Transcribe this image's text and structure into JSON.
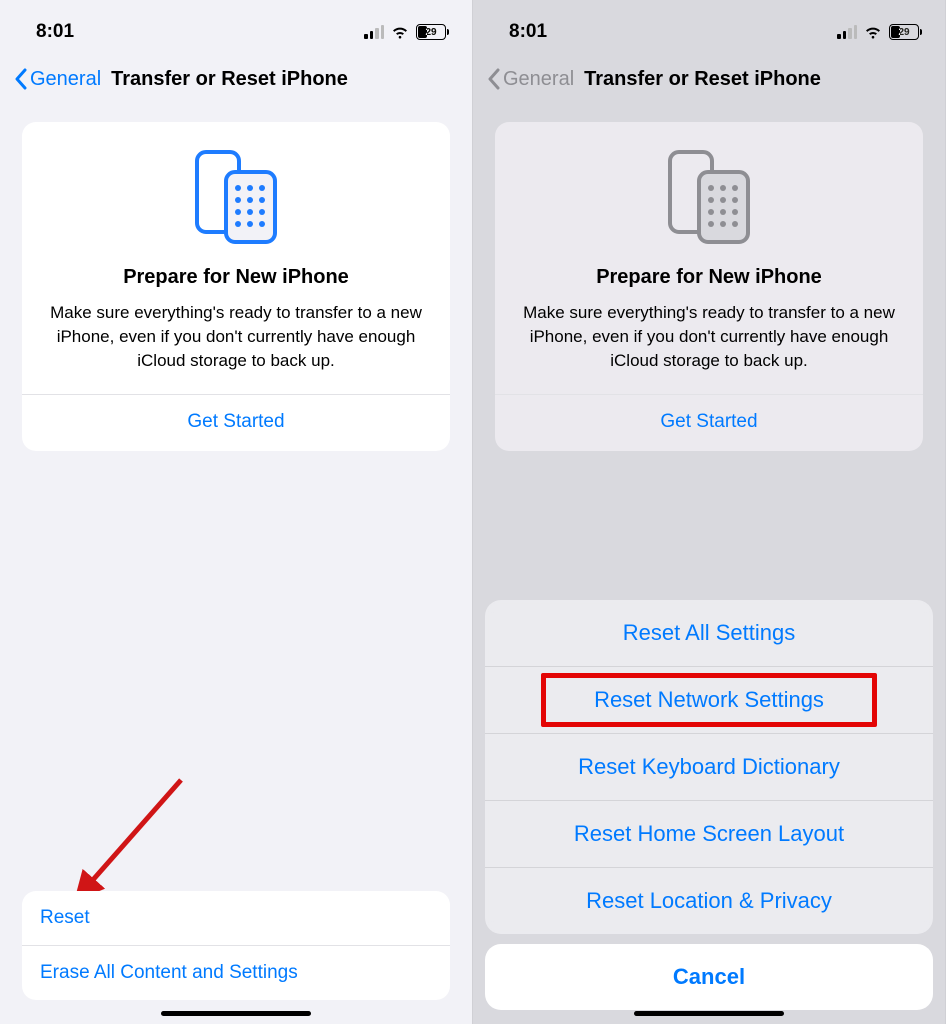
{
  "status": {
    "time": "8:01",
    "battery": "29"
  },
  "nav": {
    "back": "General",
    "title": "Transfer or Reset iPhone"
  },
  "card": {
    "title": "Prepare for New iPhone",
    "desc": "Make sure everything's ready to transfer to a new iPhone, even if you don't currently have enough iCloud storage to back up.",
    "action": "Get Started"
  },
  "rows": {
    "reset": "Reset",
    "erase": "Erase All Content and Settings"
  },
  "sheet": {
    "opt1": "Reset All Settings",
    "opt2": "Reset Network Settings",
    "opt3": "Reset Keyboard Dictionary",
    "opt4": "Reset Home Screen Layout",
    "opt5": "Reset Location & Privacy",
    "cancel": "Cancel"
  }
}
